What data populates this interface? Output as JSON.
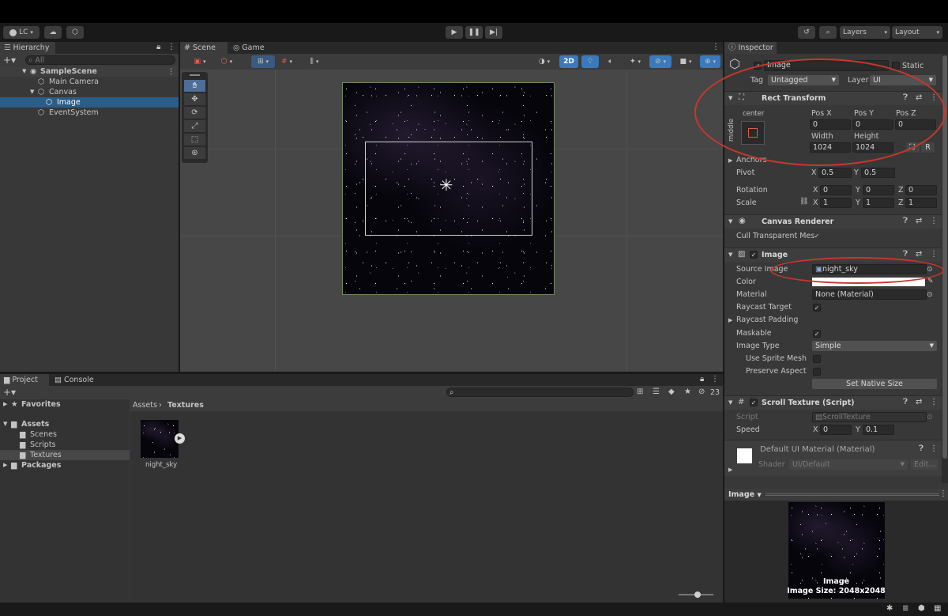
{
  "toolbar": {
    "account": "LC",
    "layers": "Layers",
    "layout": "Layout"
  },
  "hierarchy": {
    "tab": "Hierarchy",
    "search_placeholder": "All",
    "items": [
      {
        "label": "SampleScene"
      },
      {
        "label": "Main Camera"
      },
      {
        "label": "Canvas"
      },
      {
        "label": "Image"
      },
      {
        "label": "EventSystem"
      }
    ]
  },
  "scene": {
    "tabs": [
      "Scene",
      "Game"
    ],
    "mode_2d": "2D"
  },
  "project": {
    "tabs": [
      "Project",
      "Console"
    ],
    "tree": [
      {
        "label": "Favorites"
      },
      {
        "label": "Assets"
      },
      {
        "label": "Scenes"
      },
      {
        "label": "Scripts"
      },
      {
        "label": "Textures"
      },
      {
        "label": "Packages"
      }
    ],
    "breadcrumb": [
      "Assets",
      "Textures"
    ],
    "asset_name": "night_sky",
    "hidden_count": "23"
  },
  "inspector": {
    "tab": "Inspector",
    "object_name": "Image",
    "static_label": "Static",
    "tag_label": "Tag",
    "tag_value": "Untagged",
    "layer_label": "Layer",
    "layer_value": "UI",
    "rect_transform": {
      "title": "Rect Transform",
      "anchor_h": "center",
      "anchor_v": "middle",
      "pos_x_label": "Pos X",
      "pos_y_label": "Pos Y",
      "pos_z_label": "Pos Z",
      "pos_x": "0",
      "pos_y": "0",
      "pos_z": "0",
      "width_label": "Width",
      "height_label": "Height",
      "width": "1024",
      "height": "1024",
      "r_button": "R",
      "anchors_label": "Anchors",
      "pivot_label": "Pivot",
      "pivot_x": "0.5",
      "pivot_y": "0.5",
      "rotation_label": "Rotation",
      "rot_x": "0",
      "rot_y": "0",
      "rot_z": "0",
      "scale_label": "Scale",
      "scale_x": "1",
      "scale_y": "1",
      "scale_z": "1"
    },
    "canvas_renderer": {
      "title": "Canvas Renderer",
      "cull_label": "Cull Transparent Mes"
    },
    "image": {
      "title": "Image",
      "source_label": "Source Image",
      "source_value": "night_sky",
      "color_label": "Color",
      "material_label": "Material",
      "material_value": "None (Material)",
      "raycast_target_label": "Raycast Target",
      "raycast_padding_label": "Raycast Padding",
      "maskable_label": "Maskable",
      "image_type_label": "Image Type",
      "image_type_value": "Simple",
      "use_sprite_mesh_label": "Use Sprite Mesh",
      "preserve_aspect_label": "Preserve Aspect",
      "native_size_button": "Set Native Size"
    },
    "scroll_texture": {
      "title": "Scroll Texture (Script)",
      "script_label": "Script",
      "script_value": "ScrollTexture",
      "speed_label": "Speed",
      "speed_x": "0",
      "speed_y": "0.1"
    },
    "material": {
      "title": "Default UI Material (Material)",
      "shader_label": "Shader",
      "shader_value": "UI/Default",
      "edit_button": "Edit..."
    },
    "preview": {
      "dropdown": "Image",
      "name": "Image",
      "size": "Image Size: 2048x2048"
    },
    "axis": {
      "x": "X",
      "y": "Y",
      "z": "Z"
    }
  },
  "colors": {
    "annotation": "#c8372d",
    "selection": "#2c5d87",
    "accent_blue": "#3a79bb"
  }
}
